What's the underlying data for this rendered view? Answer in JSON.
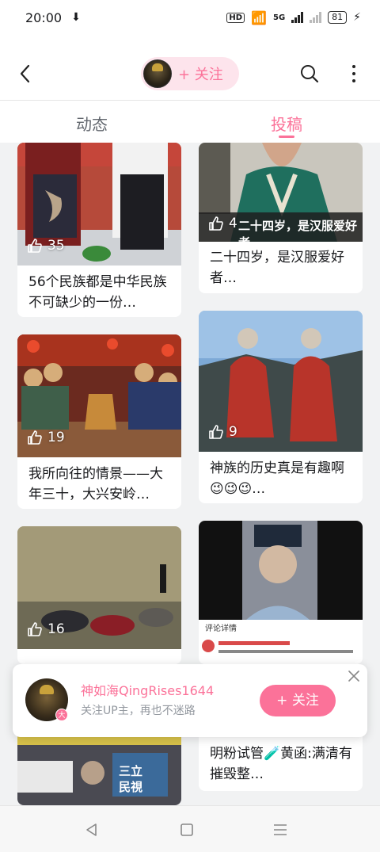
{
  "status_bar": {
    "time": "20:00",
    "battery": "81",
    "network": "5G"
  },
  "header": {
    "follow_label": "+ 关注"
  },
  "tabs": [
    {
      "label": "动态"
    },
    {
      "label": "投稿"
    }
  ],
  "cards": [
    {
      "likes": "35",
      "title": "56个民族都是中华民族不可缺少的一份…"
    },
    {
      "likes": "4",
      "title": "二十四岁，是汉服爱好者…",
      "overlay_text": "二十四岁，是汉服爱好者"
    },
    {
      "likes": "19",
      "title": "我所向往的情景——大年三十，大兴安岭…"
    },
    {
      "likes": "9",
      "title": "神族的历史真是有趣啊😉😉😉…"
    },
    {
      "likes": "16",
      "title": ""
    },
    {
      "likes": "",
      "title": "",
      "comment_header": "评论详情"
    },
    {
      "likes": "",
      "title": "",
      "image_text_1": "三立",
      "image_text_2": "民視"
    },
    {
      "likes": "",
      "title": "明粉试管🧪黄函:满清有摧毁整…"
    }
  ],
  "popup": {
    "name": "神如海QingRises1644",
    "subtitle": "关注UP主，再也不迷路",
    "follow_label": "+ 关注",
    "badge": "大"
  },
  "colors": {
    "accent": "#fb7299",
    "accent_light": "#fde4ec"
  }
}
